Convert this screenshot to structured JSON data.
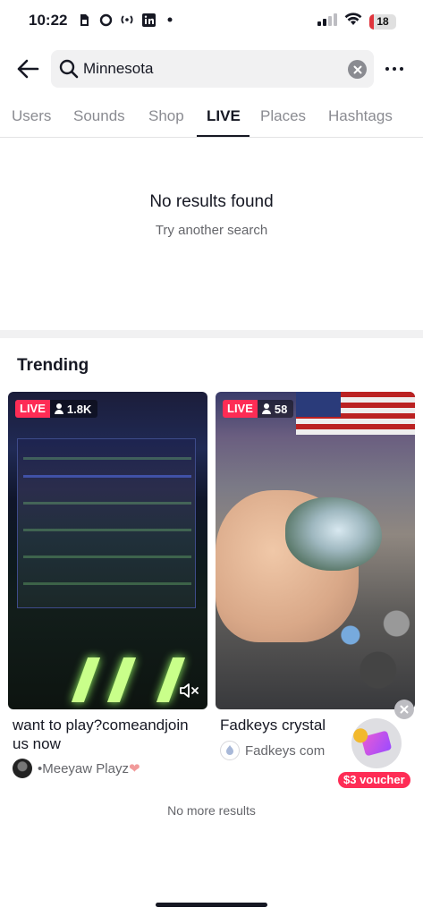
{
  "status_bar": {
    "time": "10:22",
    "battery": "18",
    "battery_fraction": 0.18,
    "icons": [
      "sim-icon",
      "circle-icon",
      "broadcast-icon",
      "linkedin-icon",
      "dot-icon",
      "signal-icon",
      "wifi-icon",
      "battery-icon"
    ]
  },
  "search": {
    "query": "Minnesota",
    "placeholder": "Search"
  },
  "tabs": [
    {
      "label": "Users",
      "active": false
    },
    {
      "label": "Sounds",
      "active": false
    },
    {
      "label": "Shop",
      "active": false
    },
    {
      "label": "LIVE",
      "active": true
    },
    {
      "label": "Places",
      "active": false
    },
    {
      "label": "Hashtags",
      "active": false
    }
  ],
  "no_results": {
    "title": "No results found",
    "subtitle": "Try another search"
  },
  "trending": {
    "title": "Trending",
    "cards": [
      {
        "live_label": "LIVE",
        "viewers": "1.8K",
        "caption": "want to play?comeandjoin us now",
        "author": "•Meeyaw Playz",
        "author_suffix": "❤"
      },
      {
        "live_label": "LIVE",
        "viewers": "58",
        "caption": "Fadkeys crystal",
        "author": "Fadkeys com"
      }
    ]
  },
  "voucher": {
    "label": "$3 voucher"
  },
  "footer": {
    "no_more": "No more results"
  },
  "colors": {
    "accent": "#fe2c55",
    "text": "#161823",
    "muted": "#65666b"
  }
}
